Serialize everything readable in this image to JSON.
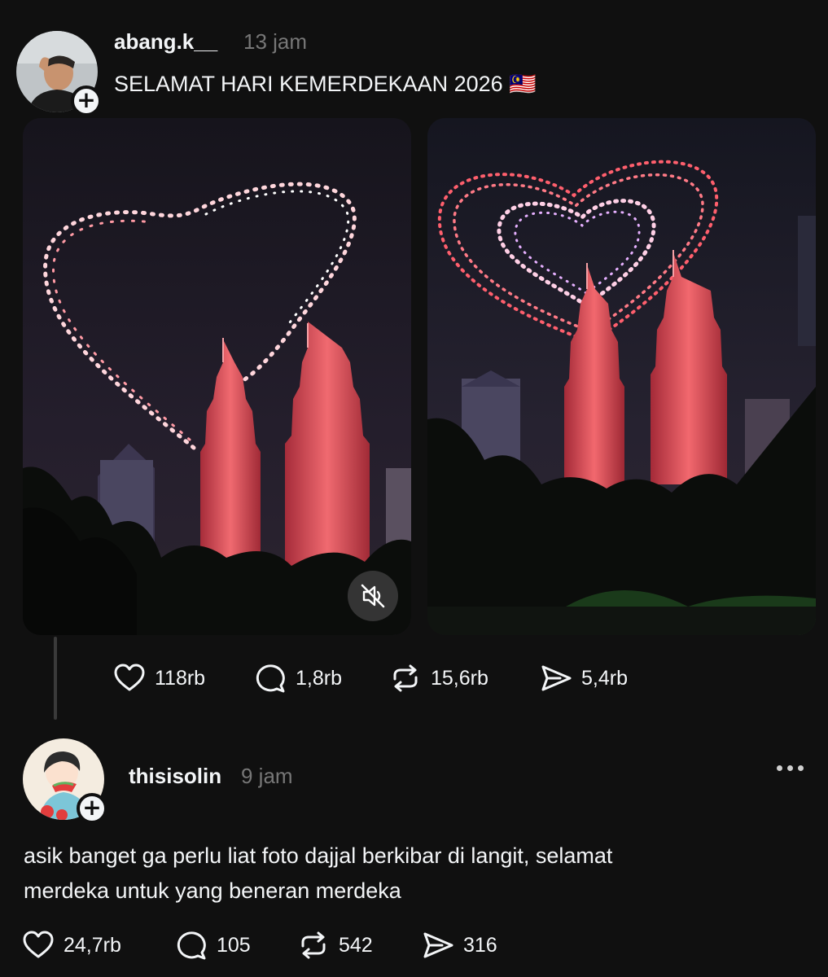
{
  "post1": {
    "username": "abang.k__",
    "time": "13 jam",
    "text": "SELAMAT HARI KEMERDEKAAN 2026 🇲🇾",
    "likes": "118rb",
    "comments": "1,8rb",
    "reposts": "15,6rb",
    "shares": "5,4rb"
  },
  "post2": {
    "username": "thisisolin",
    "time": "9 jam",
    "text_line1": "asik banget ga perlu liat foto dajjal berkibar di langit, selamat",
    "text_line2": "merdeka untuk yang beneran merdeka",
    "likes": "24,7rb",
    "comments": "105",
    "reposts": "542",
    "shares": "316"
  },
  "icons": {
    "like": "heart-icon",
    "comment": "speech-bubble-icon",
    "repost": "repost-arrows-icon",
    "share": "paper-plane-icon",
    "mute": "speaker-muted-icon",
    "follow": "plus-icon",
    "more": "more-dots-icon"
  },
  "colors": {
    "background": "#101010",
    "text": "#f3f5f7",
    "muted": "#777777",
    "tower": "#e8565e",
    "drone_light": "#ffd6dc"
  }
}
